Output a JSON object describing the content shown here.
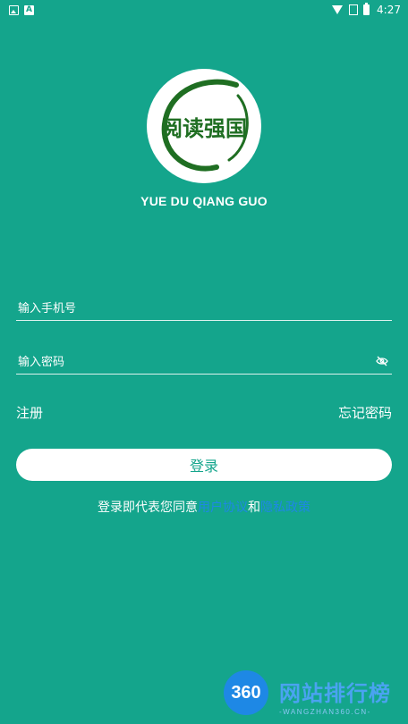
{
  "status_bar": {
    "time": "4:27",
    "icons_left": [
      "image-icon",
      "app-a-icon"
    ],
    "icons_right": [
      "wifi-icon",
      "signal-icon",
      "battery-icon"
    ]
  },
  "logo": {
    "text": "阅读强国",
    "ring_color": "#1f6e22"
  },
  "app_title": "YUE DU QIANG GUO",
  "form": {
    "phone_placeholder": "输入手机号",
    "password_placeholder": "输入密码",
    "password_toggle_icon": "eye-off-icon"
  },
  "links": {
    "register": "注册",
    "forgot_password": "忘记密码"
  },
  "login_button": "登录",
  "agreement": {
    "prefix": "登录即代表您同意",
    "user_agreement": "用户协议",
    "and": "和",
    "privacy_policy": "隐私政策"
  },
  "watermark": {
    "badge": "360",
    "title": "网站排行榜",
    "subtitle": "-WANGZHAN360.CN-"
  },
  "colors": {
    "background": "#14A58C",
    "link": "#1E88E5",
    "button_text": "#14A58C"
  }
}
